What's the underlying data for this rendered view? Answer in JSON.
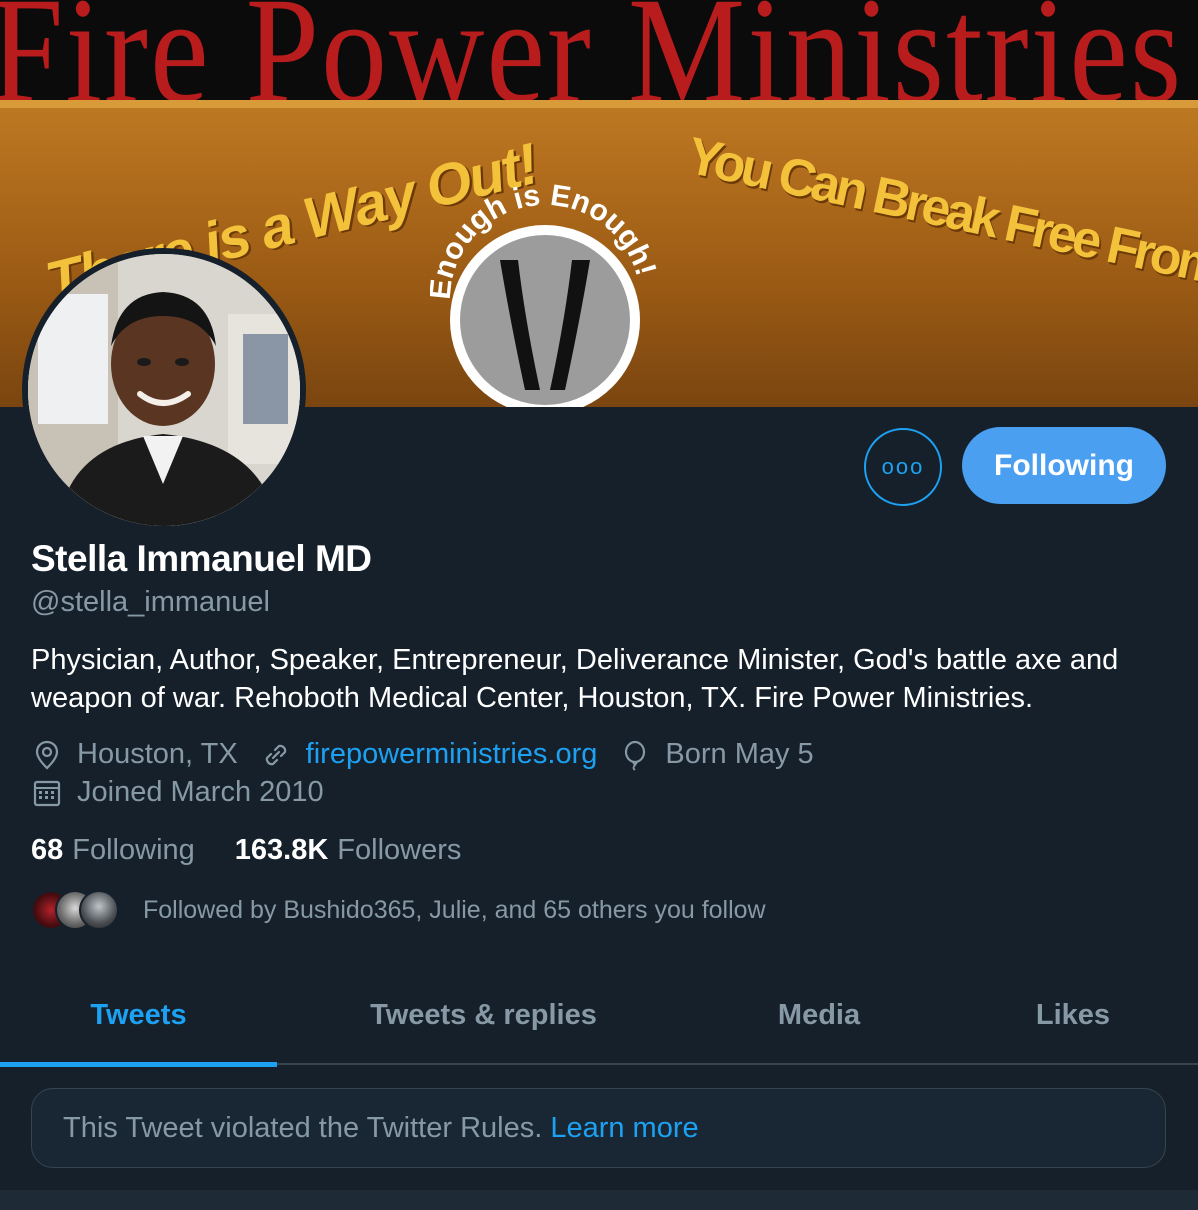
{
  "banner": {
    "title": "Fire Power Ministries",
    "left_slogan": "There is a Way Out!",
    "emblem_text": "Enough is Enough!",
    "right_slogan": "You Can Break Free From Your Past!"
  },
  "profile": {
    "name": "Stella Immanuel MD",
    "handle": "@stella_immanuel",
    "bio": "Physician, Author, Speaker, Entrepreneur, Deliverance Minister, God's battle axe and weapon of war. Rehoboth Medical Center, Houston, TX. Fire Power Ministries.",
    "location": "Houston, TX",
    "website": "firepowerministries.org",
    "birthday": "Born May 5",
    "joined": "Joined March 2010"
  },
  "actions": {
    "more_label": "ooo",
    "follow_label": "Following"
  },
  "stats": {
    "following_count": "68",
    "following_label": "Following",
    "followers_count": "163.8K",
    "followers_label": "Followers"
  },
  "followed_by": "Followed by Bushido365, Julie, and 65 others you follow",
  "tabs": [
    {
      "label": "Tweets",
      "active": true
    },
    {
      "label": "Tweets & replies",
      "active": false
    },
    {
      "label": "Media",
      "active": false
    },
    {
      "label": "Likes",
      "active": false
    }
  ],
  "notice": {
    "text": "This Tweet violated the Twitter Rules.",
    "link": "Learn more"
  },
  "colors": {
    "background": "#15202b",
    "accent": "#1da1f2",
    "secondary_text": "#8899a6"
  }
}
